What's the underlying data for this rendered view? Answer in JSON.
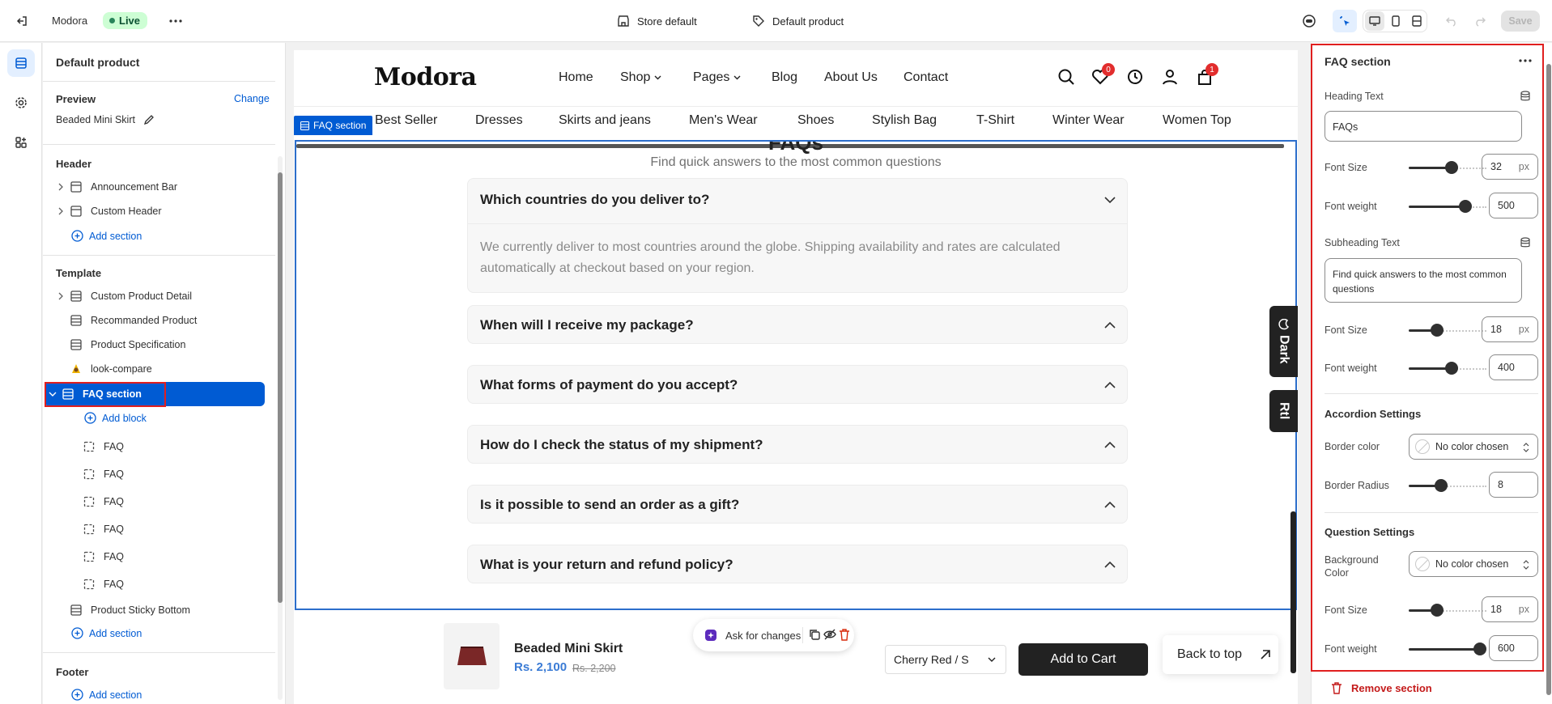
{
  "topbar": {
    "store_name": "Modora",
    "live_label": "Live",
    "store_default": "Store default",
    "default_product": "Default product",
    "save_label": "Save"
  },
  "sidebar": {
    "title": "Default product",
    "preview_label": "Preview",
    "change_label": "Change",
    "preview_product": "Beaded Mini Skirt",
    "header_group": "Header",
    "header_items": [
      {
        "label": "Announcement Bar"
      },
      {
        "label": "Custom Header"
      }
    ],
    "add_section": "Add section",
    "template_group": "Template",
    "template_items": [
      {
        "label": "Custom Product Detail"
      },
      {
        "label": "Recommanded Product"
      },
      {
        "label": "Product Specification"
      },
      {
        "label": "look-compare"
      },
      {
        "label": "FAQ section"
      }
    ],
    "add_block": "Add block",
    "faq_blocks": [
      "FAQ",
      "FAQ",
      "FAQ",
      "FAQ",
      "FAQ",
      "FAQ"
    ],
    "sticky_bottom": "Product Sticky Bottom",
    "footer_group": "Footer"
  },
  "preview": {
    "logo": "Modora",
    "nav": [
      "Home",
      "Shop",
      "Pages",
      "Blog",
      "About Us",
      "Contact"
    ],
    "wishlist_count": "0",
    "cart_count": "1",
    "categories": [
      "Best Seller",
      "Dresses",
      "Skirts and jeans",
      "Men's Wear",
      "Shoes",
      "Stylish Bag",
      "T-Shirt",
      "Winter Wear",
      "Women Top"
    ],
    "section_tag": "FAQ section",
    "faq_heading": "FAQs",
    "faq_subheading": "Find quick answers to the most common questions",
    "faqs": [
      {
        "q": "Which countries do you deliver to?",
        "a": "We currently deliver to most countries around the globe. Shipping availability and rates are calculated automatically at checkout based on your region."
      },
      {
        "q": "When will I receive my package?"
      },
      {
        "q": "What forms of payment do you accept?"
      },
      {
        "q": "How do I check the status of my shipment?"
      },
      {
        "q": "Is it possible to send an order as a gift?"
      },
      {
        "q": "What is your return and refund policy?"
      }
    ],
    "dark_tab": "Dark",
    "rtl_tab": "Rtl",
    "sticky": {
      "product": "Beaded Mini Skirt",
      "price": "Rs. 2,100",
      "old_price": "Rs. 2,200",
      "variant": "Cherry Red / S",
      "add_to_cart": "Add to Cart",
      "back_to_top": "Back to top"
    },
    "ask_changes": "Ask for changes"
  },
  "panel": {
    "title": "FAQ section",
    "heading_text_label": "Heading Text",
    "heading_text_value": "FAQs",
    "font_size_label": "Font Size",
    "font_weight_label": "Font weight",
    "heading_font_size": "32",
    "heading_font_weight": "500",
    "subheading_text_label": "Subheading Text",
    "subheading_text_value": "Find quick answers to the most common questions",
    "sub_font_size": "18",
    "sub_font_weight": "400",
    "accordion_settings": "Accordion Settings",
    "border_color_label": "Border color",
    "no_color": "No color chosen",
    "border_radius_label": "Border Radius",
    "border_radius_value": "8",
    "question_settings": "Question Settings",
    "background_color_label": "Background Color",
    "q_font_size": "18",
    "q_font_weight": "600",
    "px": "px",
    "remove_section": "Remove section"
  },
  "colors": {
    "accent": "#005bd3",
    "live_bg": "#cdfed4",
    "highlight_red": "#e01f1f",
    "dark": "#222222"
  }
}
